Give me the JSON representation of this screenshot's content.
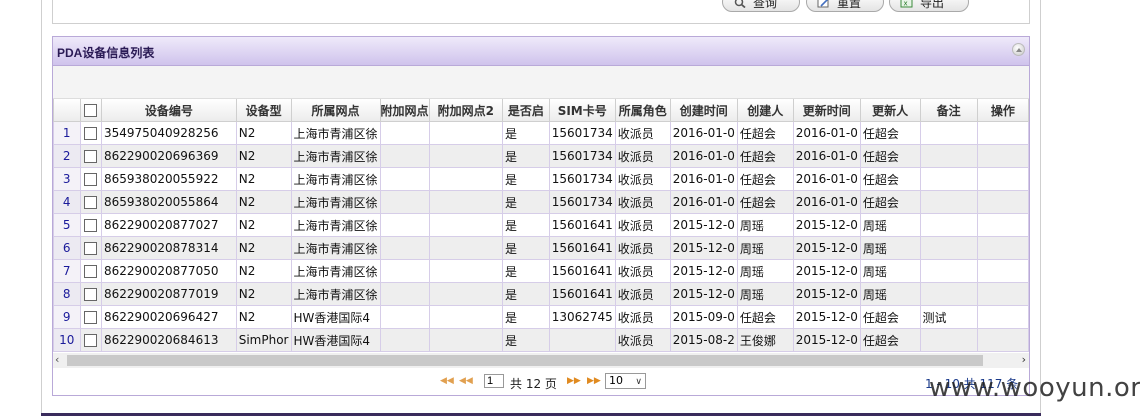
{
  "toolbar": {
    "query_label": "查询",
    "reset_label": "重置",
    "export_label": "导出"
  },
  "panel": {
    "title": "PDA设备信息列表"
  },
  "table": {
    "columns": [
      "设备编号",
      "设备型",
      "所属网点",
      "附加网点",
      "附加网点2",
      "是否启",
      "SIM卡号",
      "所属角色",
      "创建时间",
      "创建人",
      "更新时间",
      "更新人",
      "备注",
      "操作"
    ],
    "rows": [
      {
        "num": "1",
        "device": "354975040928256",
        "model": "N2",
        "site": "上海市青浦区徐",
        "extra1": "",
        "extra2": "",
        "enabled": "是",
        "sim": "15601734",
        "role": "收派员",
        "created": "2016-01-0",
        "creator": "任超会",
        "updated": "2016-01-0",
        "updater": "任超会",
        "remark": "",
        "op": ""
      },
      {
        "num": "2",
        "device": "862290020696369",
        "model": "N2",
        "site": "上海市青浦区徐",
        "extra1": "",
        "extra2": "",
        "enabled": "是",
        "sim": "15601734",
        "role": "收派员",
        "created": "2016-01-0",
        "creator": "任超会",
        "updated": "2016-01-0",
        "updater": "任超会",
        "remark": "",
        "op": ""
      },
      {
        "num": "3",
        "device": "865938020055922",
        "model": "N2",
        "site": "上海市青浦区徐",
        "extra1": "",
        "extra2": "",
        "enabled": "是",
        "sim": "15601734",
        "role": "收派员",
        "created": "2016-01-0",
        "creator": "任超会",
        "updated": "2016-01-0",
        "updater": "任超会",
        "remark": "",
        "op": ""
      },
      {
        "num": "4",
        "device": "865938020055864",
        "model": "N2",
        "site": "上海市青浦区徐",
        "extra1": "",
        "extra2": "",
        "enabled": "是",
        "sim": "15601734",
        "role": "收派员",
        "created": "2016-01-0",
        "creator": "任超会",
        "updated": "2016-01-0",
        "updater": "任超会",
        "remark": "",
        "op": ""
      },
      {
        "num": "5",
        "device": "862290020877027",
        "model": "N2",
        "site": "上海市青浦区徐",
        "extra1": "",
        "extra2": "",
        "enabled": "是",
        "sim": "15601641",
        "role": "收派员",
        "created": "2015-12-0",
        "creator": "周瑶",
        "updated": "2015-12-0",
        "updater": "周瑶",
        "remark": "",
        "op": ""
      },
      {
        "num": "6",
        "device": "862290020878314",
        "model": "N2",
        "site": "上海市青浦区徐",
        "extra1": "",
        "extra2": "",
        "enabled": "是",
        "sim": "15601641",
        "role": "收派员",
        "created": "2015-12-0",
        "creator": "周瑶",
        "updated": "2015-12-0",
        "updater": "周瑶",
        "remark": "",
        "op": ""
      },
      {
        "num": "7",
        "device": "862290020877050",
        "model": "N2",
        "site": "上海市青浦区徐",
        "extra1": "",
        "extra2": "",
        "enabled": "是",
        "sim": "15601641",
        "role": "收派员",
        "created": "2015-12-0",
        "creator": "周瑶",
        "updated": "2015-12-0",
        "updater": "周瑶",
        "remark": "",
        "op": ""
      },
      {
        "num": "8",
        "device": "862290020877019",
        "model": "N2",
        "site": "上海市青浦区徐",
        "extra1": "",
        "extra2": "",
        "enabled": "是",
        "sim": "15601641",
        "role": "收派员",
        "created": "2015-12-0",
        "creator": "周瑶",
        "updated": "2015-12-0",
        "updater": "周瑶",
        "remark": "",
        "op": ""
      },
      {
        "num": "9",
        "device": "862290020696427",
        "model": "N2",
        "site": "HW香港国际4",
        "extra1": "",
        "extra2": "",
        "enabled": "是",
        "sim": "13062745",
        "role": "收派员",
        "created": "2015-09-0",
        "creator": "任超会",
        "updated": "2015-12-0",
        "updater": "任超会",
        "remark": "测试",
        "op": ""
      },
      {
        "num": "10",
        "device": "862290020684613",
        "model": "SimPhor",
        "site": "HW香港国际4",
        "extra1": "",
        "extra2": "",
        "enabled": "是",
        "sim": "",
        "role": "收派员",
        "created": "2015-08-2",
        "creator": "王俊娜",
        "updated": "2015-12-0",
        "updater": "任超会",
        "remark": "",
        "op": ""
      }
    ]
  },
  "pager": {
    "first_icon": "first-page-icon",
    "prev_icon": "prev-page-icon",
    "next_icon": "next-page-icon",
    "last_icon": "last-page-icon",
    "page_value": "1",
    "total_pages_text": "共 12 页",
    "page_size": "10",
    "summary": "1 - 10 共 117 条"
  },
  "watermark": "www.wooyun.org"
}
